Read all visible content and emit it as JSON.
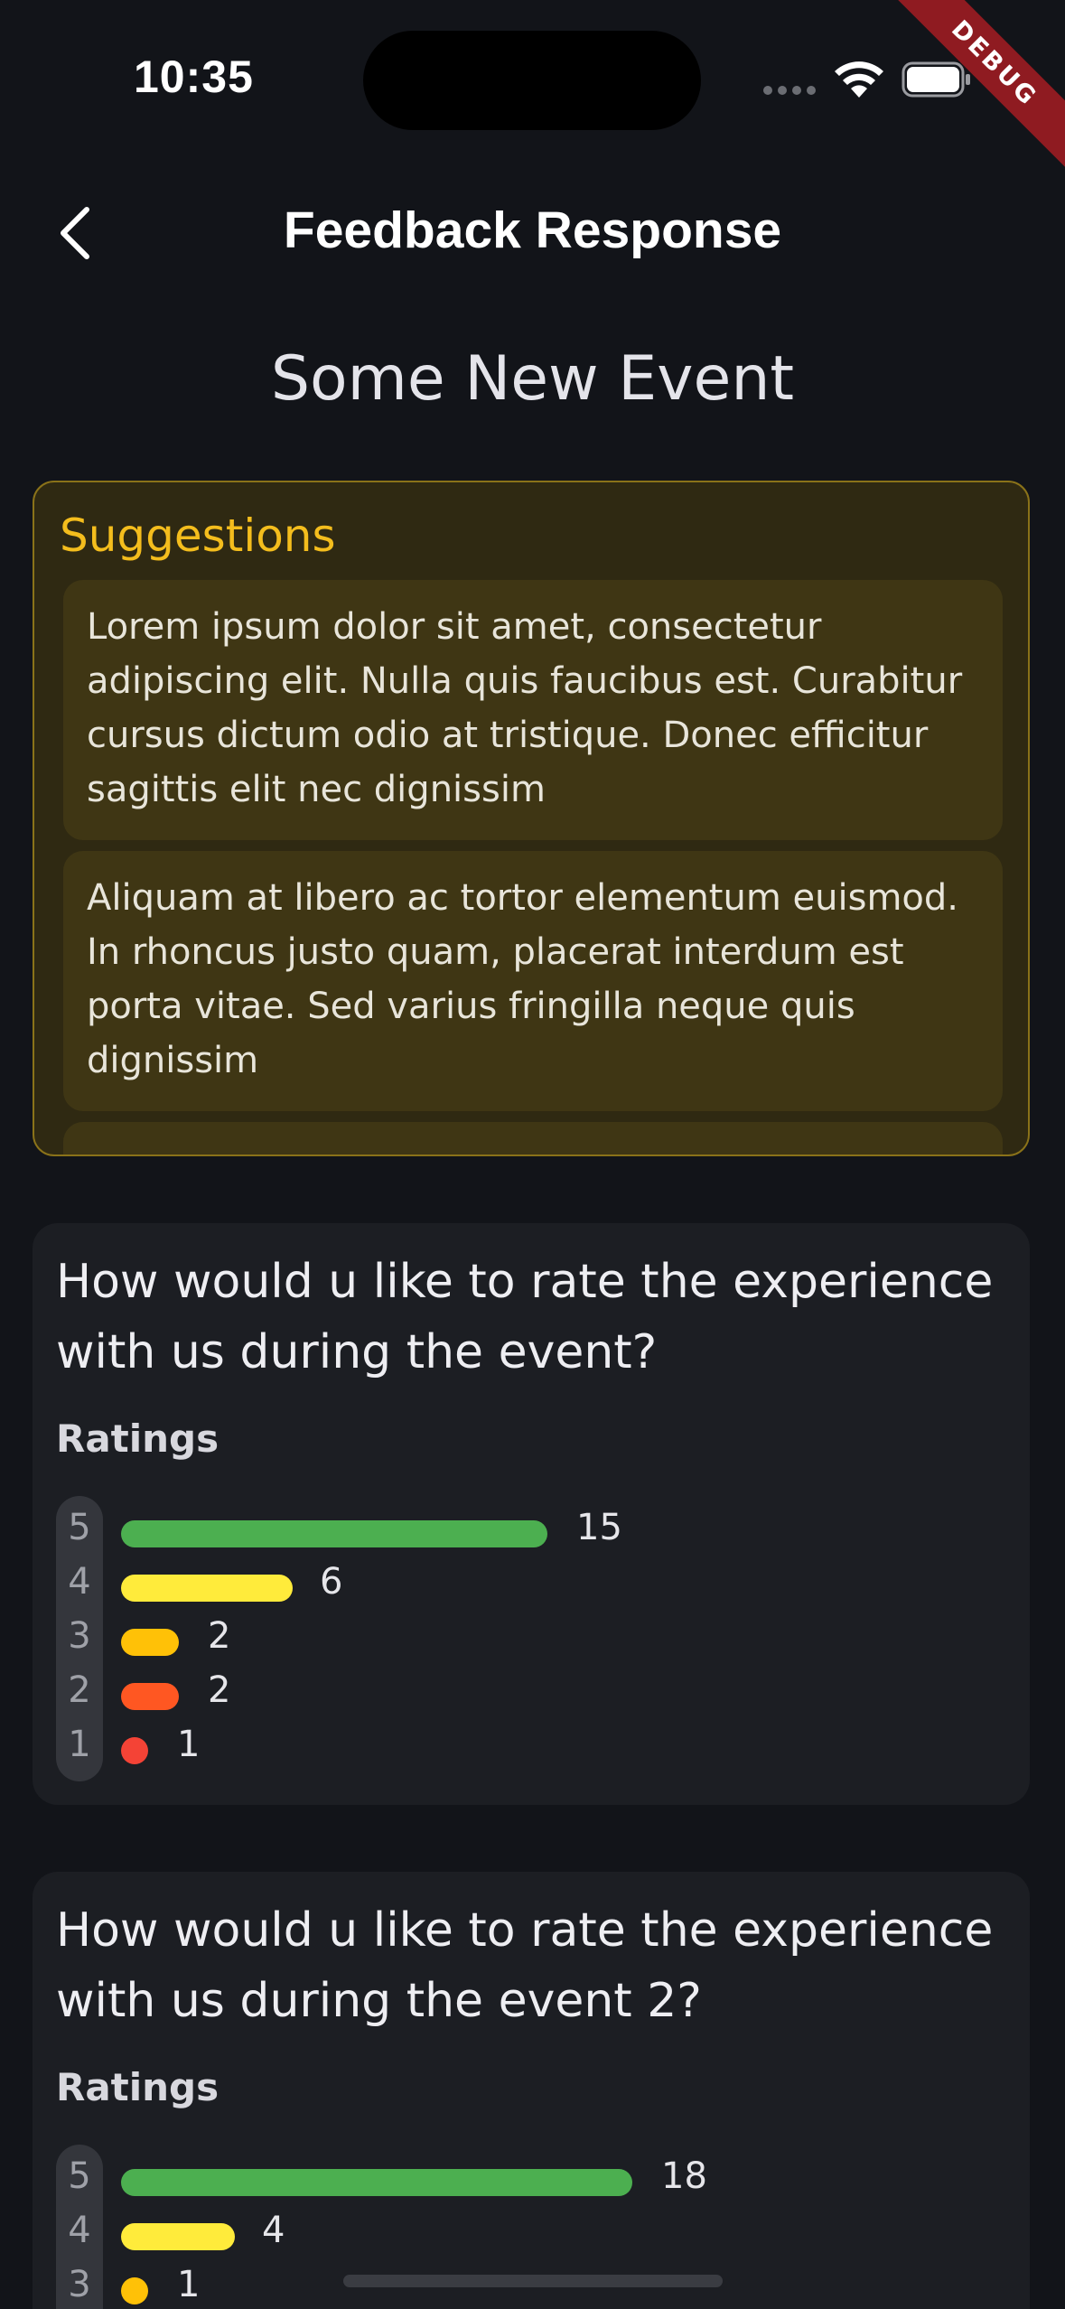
{
  "status_bar": {
    "time": "10:35",
    "debug_label": "DEBUG"
  },
  "header": {
    "title": "Feedback Response",
    "back_icon": "chevron-left-icon"
  },
  "event": {
    "title": "Some New Event"
  },
  "suggestions": {
    "title": "Suggestions",
    "items": [
      "Lorem ipsum dolor sit amet, consectetur adipiscing elit. Nulla quis faucibus est. Curabitur cursus dictum odio at tristique. Donec efficitur sagittis elit nec dignissim",
      "Aliquam at libero ac tortor elementum euismod. In rhoncus justo quam, placerat interdum est porta vitae. Sed varius fringilla neque quis dignissim"
    ]
  },
  "questions": [
    {
      "question": "How would u like to rate the experience with us during the event?",
      "ratings_label": "Ratings",
      "scale": [
        "5",
        "4",
        "3",
        "2",
        "1"
      ],
      "counts": [
        "15",
        "6",
        "2",
        "2",
        "1"
      ]
    },
    {
      "question": "How would u like to rate the experience with us during the event 2?",
      "ratings_label": "Ratings",
      "scale": [
        "5",
        "4",
        "3"
      ],
      "counts": [
        "18",
        "4",
        "1"
      ]
    }
  ],
  "colors": {
    "background": "#121419",
    "accent": "#f4bd1d",
    "rating_5": "#4caf50",
    "rating_4": "#ffeb3b",
    "rating_3": "#ffc107",
    "rating_2": "#ff5722",
    "rating_1": "#f44336"
  }
}
